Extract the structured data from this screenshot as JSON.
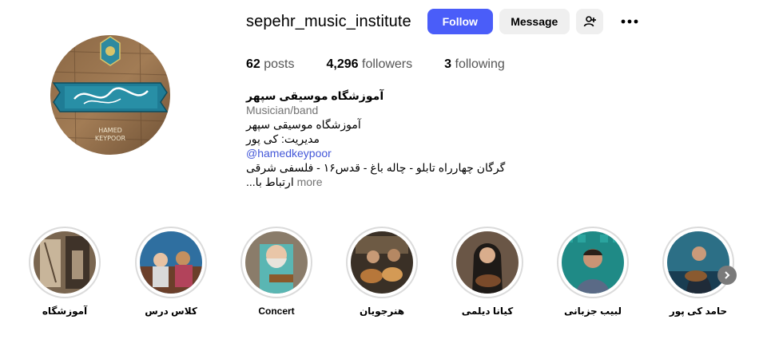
{
  "profile": {
    "username": "sepehr_music_institute",
    "follow_label": "Follow",
    "message_label": "Message",
    "stats": [
      {
        "value": "62",
        "label": "posts"
      },
      {
        "value": "4,296",
        "label": "followers"
      },
      {
        "value": "3",
        "label": "following"
      }
    ],
    "bio": {
      "name": "آموزشگاه موسیقی سپهر",
      "category": "Musician/band",
      "line1": "آموزشگاه موسیقی سپهر",
      "line2": "مدیریت: کی پور",
      "mention": "@hamedkeypoor",
      "line3": "گرگان چهارراه تابلو - چاله باغ - قدس۱۶ - فلسفی شرقی",
      "line4": "...ارتباط با",
      "more": "more"
    },
    "avatar_text": {
      "line1": "HAMED",
      "line2": "KEYPOOR"
    }
  },
  "highlights": [
    {
      "label": "آموزشگاه"
    },
    {
      "label": "کلاس درس"
    },
    {
      "label": "Concert"
    },
    {
      "label": "هنرجویان"
    },
    {
      "label": "کیانا دیلمی"
    },
    {
      "label": "لبیب جزبانی"
    },
    {
      "label": "حامد کی پور"
    }
  ],
  "icons": {
    "add_user": "add-user-icon",
    "more": "more-options-icon",
    "next": "chevron-right-icon"
  },
  "colors": {
    "follow": "#4a5df9",
    "secondary_button": "#efefef",
    "link": "#4357d8",
    "ring": "#dbdbdb"
  }
}
